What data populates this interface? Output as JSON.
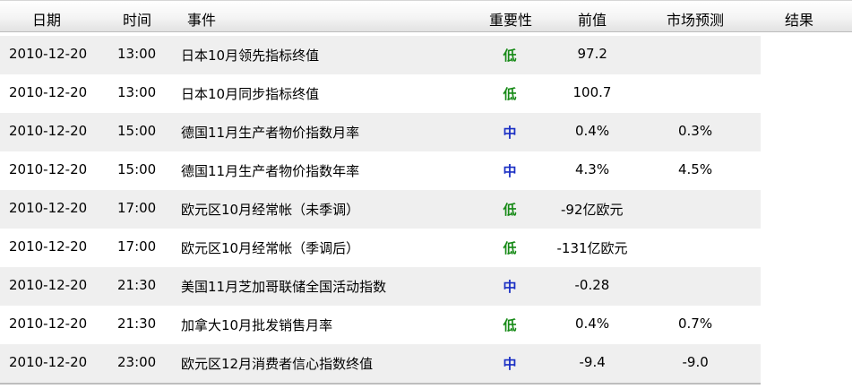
{
  "columns": {
    "date": "日期",
    "time": "时间",
    "event": "事件",
    "importance": "重要性",
    "previous": "前值",
    "forecast": "市场预测",
    "result": "结果"
  },
  "rows": [
    {
      "date": "2010-12-20",
      "time": "13:00",
      "event": "日本10月领先指标终值",
      "importance": "低",
      "importance_level": "low",
      "previous": "97.2",
      "forecast": "",
      "result": ""
    },
    {
      "date": "2010-12-20",
      "time": "13:00",
      "event": "日本10月同步指标终值",
      "importance": "低",
      "importance_level": "low",
      "previous": "100.7",
      "forecast": "",
      "result": ""
    },
    {
      "date": "2010-12-20",
      "time": "15:00",
      "event": "德国11月生产者物价指数月率",
      "importance": "中",
      "importance_level": "medium",
      "previous": "0.4%",
      "forecast": "0.3%",
      "result": ""
    },
    {
      "date": "2010-12-20",
      "time": "15:00",
      "event": "德国11月生产者物价指数年率",
      "importance": "中",
      "importance_level": "medium",
      "previous": "4.3%",
      "forecast": "4.5%",
      "result": ""
    },
    {
      "date": "2010-12-20",
      "time": "17:00",
      "event": "欧元区10月经常帐（未季调）",
      "importance": "低",
      "importance_level": "low",
      "previous": "-92亿欧元",
      "forecast": "",
      "result": ""
    },
    {
      "date": "2010-12-20",
      "time": "17:00",
      "event": "欧元区10月经常帐（季调后）",
      "importance": "低",
      "importance_level": "low",
      "previous": "-131亿欧元",
      "forecast": "",
      "result": ""
    },
    {
      "date": "2010-12-20",
      "time": "21:30",
      "event": "美国11月芝加哥联储全国活动指数",
      "importance": "中",
      "importance_level": "medium",
      "previous": "-0.28",
      "forecast": "",
      "result": ""
    },
    {
      "date": "2010-12-20",
      "time": "21:30",
      "event": "加拿大10月批发销售月率",
      "importance": "低",
      "importance_level": "low",
      "previous": "0.4%",
      "forecast": "0.7%",
      "result": ""
    },
    {
      "date": "2010-12-20",
      "time": "23:00",
      "event": "欧元区12月消费者信心指数终值",
      "importance": "中",
      "importance_level": "medium",
      "previous": "-9.4",
      "forecast": "-9.0",
      "result": ""
    }
  ],
  "colors": {
    "importance_low": "#178a17",
    "importance_medium": "#1a2fc4",
    "row_shade": "#efefef"
  }
}
